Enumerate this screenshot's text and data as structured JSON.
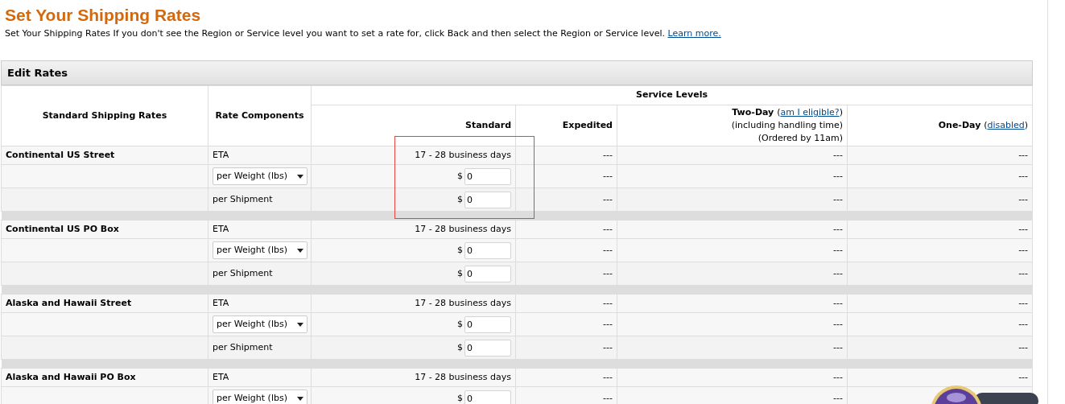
{
  "page": {
    "title": "Set Your Shipping Rates",
    "description": "Set Your Shipping Rates If you don't see the Region or Service level you want to set a rate for, click Back and then select the Region or Service level.",
    "learn_more": "Learn more."
  },
  "panel": {
    "title": "Edit Rates"
  },
  "columns": {
    "region": "Standard Shipping Rates",
    "components": "Rate Components",
    "service_levels": "Service Levels",
    "standard": "Standard",
    "expedited": "Expedited",
    "two_day": {
      "label": "Two-Day",
      "link_prefix": "(",
      "link": "am I eligible?",
      "link_suffix": ")",
      "notes": [
        "(including handling time)",
        "(Ordered by 11am)"
      ]
    },
    "one_day": {
      "label": "One-Day",
      "link_prefix": "(",
      "link": "disabled",
      "link_suffix": ")"
    }
  },
  "regions": [
    {
      "name": "Continental US Street",
      "rows": [
        {
          "kind": "eta",
          "component": "ETA",
          "standard": "17 - 28 business days",
          "expedited": "---",
          "two_day": "---",
          "one_day": "---"
        },
        {
          "kind": "select",
          "component": "per Weight (lbs)",
          "currency": "$",
          "value": "0",
          "expedited": "---",
          "two_day": "---",
          "one_day": "---"
        },
        {
          "kind": "input",
          "component": "per Shipment",
          "currency": "$",
          "value": "0",
          "expedited": "---",
          "two_day": "---",
          "one_day": "---"
        }
      ]
    },
    {
      "name": "Continental US PO Box",
      "rows": [
        {
          "kind": "eta",
          "component": "ETA",
          "standard": "17 - 28 business days",
          "expedited": "---",
          "two_day": "---",
          "one_day": "---"
        },
        {
          "kind": "select",
          "component": "per Weight (lbs)",
          "currency": "$",
          "value": "0",
          "expedited": "---",
          "two_day": "---",
          "one_day": "---"
        },
        {
          "kind": "input",
          "component": "per Shipment",
          "currency": "$",
          "value": "0",
          "expedited": "---",
          "two_day": "---",
          "one_day": "---"
        }
      ]
    },
    {
      "name": "Alaska and Hawaii Street",
      "rows": [
        {
          "kind": "eta",
          "component": "ETA",
          "standard": "17 - 28 business days",
          "expedited": "---",
          "two_day": "---",
          "one_day": "---"
        },
        {
          "kind": "select",
          "component": "per Weight (lbs)",
          "currency": "$",
          "value": "0",
          "expedited": "---",
          "two_day": "---",
          "one_day": "---"
        },
        {
          "kind": "input",
          "component": "per Shipment",
          "currency": "$",
          "value": "0",
          "expedited": "---",
          "two_day": "---",
          "one_day": "---"
        }
      ]
    },
    {
      "name": "Alaska and Hawaii PO Box",
      "rows": [
        {
          "kind": "eta",
          "component": "ETA",
          "standard": "17 - 28 business days",
          "expedited": "---",
          "two_day": "---",
          "one_day": "---"
        },
        {
          "kind": "select",
          "component": "per Weight (lbs)",
          "currency": "$",
          "value": "0",
          "expedited": "---",
          "two_day": "---"
        }
      ]
    }
  ]
}
